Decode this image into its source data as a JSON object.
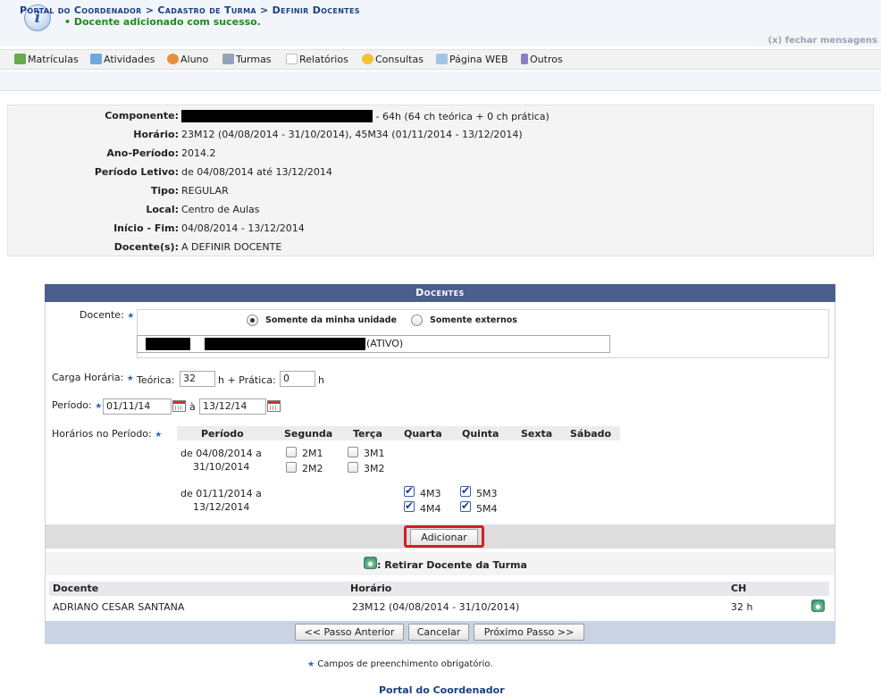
{
  "message": {
    "text": "• Docente adicionado com sucesso.",
    "close": "(x) fechar mensagens"
  },
  "menu": [
    {
      "label": "Matrículas",
      "icon": "enrollment-icon",
      "color": "#6aa84f"
    },
    {
      "label": "Atividades",
      "icon": "activities-icon",
      "color": "#6fa8dc"
    },
    {
      "label": "Aluno",
      "icon": "student-icon",
      "color": "#e69138"
    },
    {
      "label": "Turmas",
      "icon": "classes-icon",
      "color": "#93a4b8"
    },
    {
      "label": "Relatórios",
      "icon": "reports-icon",
      "color": "#cfd8e3"
    },
    {
      "label": "Consultas",
      "icon": "search-icon",
      "color": "#f1c232"
    },
    {
      "label": "Página WEB",
      "icon": "webpage-icon",
      "color": "#9fc5e8"
    },
    {
      "label": "Outros",
      "icon": "others-icon",
      "color": "#8e7cc3"
    }
  ],
  "breadcrumb": "Portal do Coordenador > Cadastro de Turma > Definir Docentes",
  "info": {
    "componente_label": "Componente:",
    "componente_value": "- 64h (64 ch teórica + 0 ch prática)",
    "horario_label": "Horário:",
    "horario_value": "23M12 (04/08/2014 - 31/10/2014), 45M34 (01/11/2014 - 13/12/2014)",
    "ano_label": "Ano-Período:",
    "ano_value": "2014.2",
    "letivo_label": "Período Letivo:",
    "letivo_value": "de 04/08/2014 até 13/12/2014",
    "tipo_label": "Tipo:",
    "tipo_value": "REGULAR",
    "local_label": "Local:",
    "local_value": "Centro de Aulas",
    "inicio_label": "Início - Fim:",
    "inicio_value": "04/08/2014 - 13/12/2014",
    "docentes_label": "Docente(s):",
    "docentes_value": "A DEFINIR DOCENTE"
  },
  "form": {
    "header": "Docentes",
    "docente_label": "Docente:",
    "radio_unit": "Somente da minha unidade",
    "radio_external": "Somente externos",
    "docente_status": "(ATIVO)",
    "carga_label": "Carga Horária:",
    "teorica_label": "Teórica:",
    "teorica_value": "32",
    "pratica_label": "h + Prática:",
    "pratica_value": "0",
    "h_label": "h",
    "periodo_label": "Período:",
    "periodo_start": "01/11/14",
    "periodo_sep": "à",
    "periodo_end": "13/12/14",
    "horarios_label": "Horários no Período:",
    "sched_headers": [
      "Período",
      "Segunda",
      "Terça",
      "Quarta",
      "Quinta",
      "Sexta",
      "Sábado"
    ],
    "period1_line1": "de 04/08/2014 a",
    "period1_line2": "31/10/2014",
    "period2_line1": "de 01/11/2014 a",
    "period2_line2": "13/12/2014",
    "slots": [
      "2M1",
      "2M2",
      "3M1",
      "3M2",
      "4M3",
      "4M4",
      "5M3",
      "5M4"
    ],
    "add_button": "Adicionar",
    "legend": ": Retirar Docente da Turma",
    "table_headers": {
      "docente": "Docente",
      "horario": "Horário",
      "ch": "CH"
    },
    "row": {
      "docente": "ADRIANO CESAR SANTANA",
      "horario": "23M12 (04/08/2014 - 31/10/2014)",
      "ch": "32 h"
    },
    "btn_prev": "<< Passo Anterior",
    "btn_cancel": "Cancelar",
    "btn_next": "Próximo Passo >>"
  },
  "footer": {
    "required_note": "Campos de preenchimento obrigatório.",
    "portal_link": "Portal do Coordenador"
  }
}
